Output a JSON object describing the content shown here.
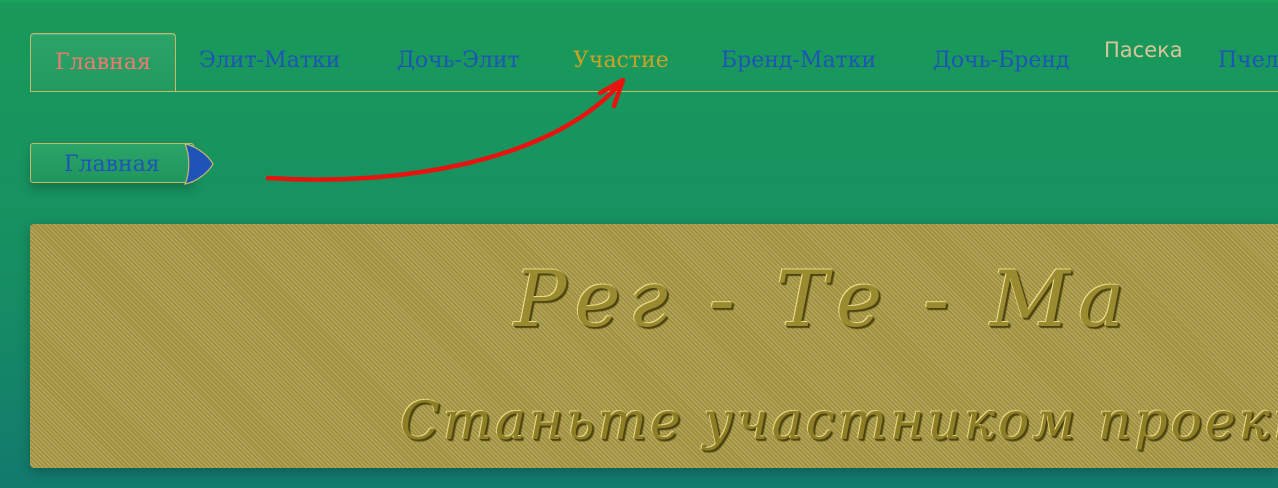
{
  "nav": {
    "tabs": [
      {
        "label": "Главная"
      },
      {
        "label": "Элит-Матки"
      },
      {
        "label": "Дочь-Элит"
      },
      {
        "label": "Участие"
      },
      {
        "label": "Бренд-Матки"
      },
      {
        "label": "Дочь-Бренд"
      },
      {
        "label": "Пасека"
      },
      {
        "label": "Пчел"
      }
    ]
  },
  "breadcrumb": {
    "label": "Главная"
  },
  "banner": {
    "title": "Рег - Те - Ма",
    "subtitle": "Станьте участником проекта"
  },
  "colors": {
    "background": "#168f62",
    "active_tab_text": "#f07a72",
    "link_blue": "#1e54b8",
    "highlight_tab": "#c9a226",
    "tan_tab": "#d8c59a",
    "banner": "#a99a45",
    "annotation_arrow": "#e8130f"
  }
}
